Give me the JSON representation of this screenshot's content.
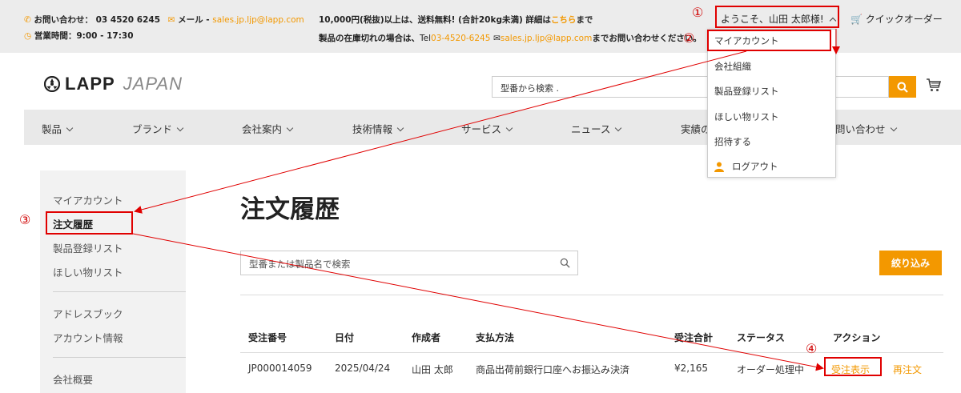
{
  "topbar": {
    "contact_label": "お問い合わせ：",
    "phone": "03 4520 6245",
    "mail_label": "メール - ",
    "mail_address": "sales.jp.ljp@lapp.com",
    "hours": "営業時間：9:00 - 17:30",
    "notice1_pre": "10,000円(税抜)以上は、送料無料! (合計20kg未満) 詳細は",
    "notice1_link": "こちら",
    "notice1_post": "まで",
    "notice2_pre": "製品の在庫切れの場合は、",
    "notice2_tel_prefix": "Tel",
    "notice2_tel": "03-4520-6245",
    "notice2_mail": "sales.jp.ljp@lapp.com",
    "notice2_post": "までお問い合わせください。",
    "welcome": "ようこそ、山田 太郎様!",
    "quick_order": "クイックオーダー"
  },
  "header": {
    "logo_brand": "LAPP",
    "logo_sub": "JAPAN",
    "search_placeholder": "型番から検索 ."
  },
  "nav": [
    {
      "label": "製品"
    },
    {
      "label": "ブランド"
    },
    {
      "label": "会社案内"
    },
    {
      "label": "技術情報"
    },
    {
      "label": "サービス"
    },
    {
      "label": "ニュース"
    },
    {
      "label": "実績の"
    },
    {
      "label": "問い合わせ"
    }
  ],
  "dropdown": [
    {
      "label": "マイアカウント"
    },
    {
      "label": "会社組織"
    },
    {
      "label": "製品登録リスト"
    },
    {
      "label": "ほしい物リスト"
    },
    {
      "label": "招待する"
    },
    {
      "label": "ログアウト"
    }
  ],
  "sidebar": [
    {
      "label": "マイアカウント"
    },
    {
      "label": "注文履歴"
    },
    {
      "label": "製品登録リスト"
    },
    {
      "label": "ほしい物リスト"
    },
    {
      "label": "アドレスブック"
    },
    {
      "label": "アカウント情報"
    },
    {
      "label": "会社概要"
    }
  ],
  "main": {
    "title": "注文履歴",
    "search_placeholder": "型番または製品名で検索",
    "filter_label": "絞り込み",
    "columns": [
      "受注番号",
      "日付",
      "作成者",
      "支払方法",
      "受注合計",
      "ステータス",
      "アクション"
    ],
    "rows": [
      {
        "order_no": "JP000014059",
        "date": "2025/04/24",
        "creator": "山田 太郎",
        "payment": "商品出荷前銀行口座へお振込み決済",
        "total": "¥2,165",
        "status": "オーダー処理中",
        "action_view": "受注表示",
        "action_reorder": "再注文"
      }
    ]
  },
  "annotations": {
    "step1": "①",
    "step2": "②",
    "step3": "③",
    "step4": "④"
  },
  "colors": {
    "accent": "#f39800",
    "annotation": "#e00000",
    "contact_icon": "#f39800"
  }
}
